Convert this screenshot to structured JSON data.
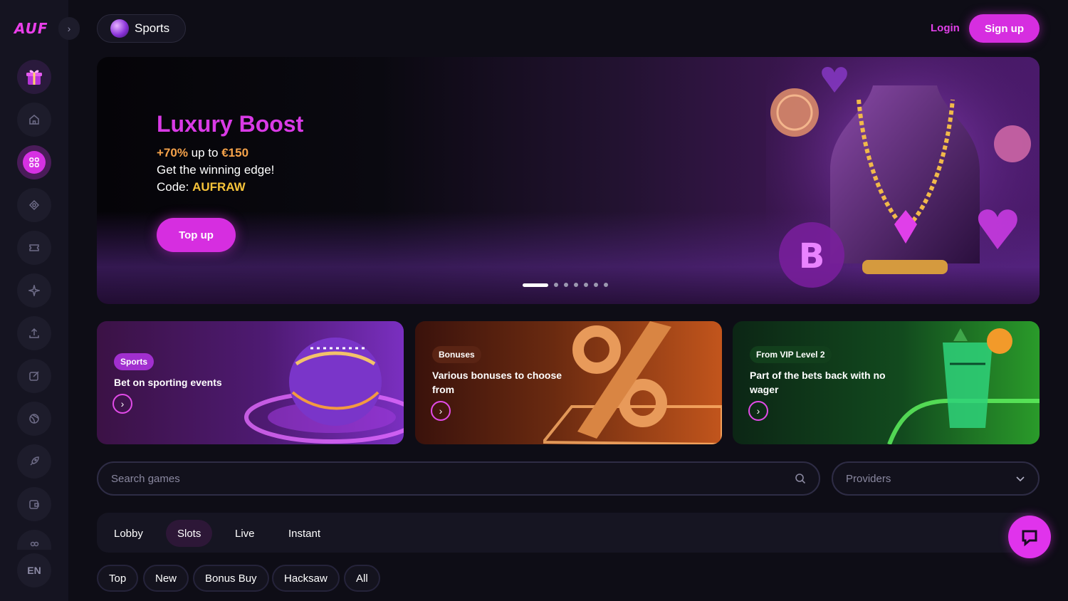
{
  "brand": {
    "logo_text": "AUF",
    "accent": "#d62ee0"
  },
  "sidebar": {
    "items": [
      {
        "name": "gift-icon"
      },
      {
        "name": "home-icon"
      },
      {
        "name": "grid-icon"
      },
      {
        "name": "poker-chip-icon"
      },
      {
        "name": "ticket-icon"
      },
      {
        "name": "sparkle-icon"
      },
      {
        "name": "upload-icon"
      },
      {
        "name": "edit-icon"
      },
      {
        "name": "globe-icon"
      },
      {
        "name": "rocket-icon"
      },
      {
        "name": "wallet-icon"
      },
      {
        "name": "users-icon"
      }
    ],
    "language": "EN"
  },
  "header": {
    "sports_label": "Sports",
    "login_label": "Login",
    "signup_label": "Sign up"
  },
  "hero": {
    "title": "Luxury Boost",
    "bonus_percent": "+70%",
    "bonus_mid": " up to ",
    "bonus_amount": "€150",
    "tagline": "Get the winning edge!",
    "code_label": "Code: ",
    "code_value": "AUFRAW",
    "button_label": "Top up",
    "slide_count": 7,
    "active_slide": 1
  },
  "promos": [
    {
      "badge": "Sports",
      "text": "Bet on sporting events"
    },
    {
      "badge": "Bonuses",
      "text": "Various bonuses to choose from"
    },
    {
      "badge": "From VIP Level 2",
      "text": "Part of the bets back with no wager"
    }
  ],
  "search": {
    "placeholder": "Search games"
  },
  "providers": {
    "label": "Providers"
  },
  "tabs": [
    "Lobby",
    "Slots",
    "Live",
    "Instant"
  ],
  "active_tab": "Slots",
  "chips": [
    "Top",
    "New",
    "Bonus Buy",
    "Hacksaw",
    "All"
  ]
}
